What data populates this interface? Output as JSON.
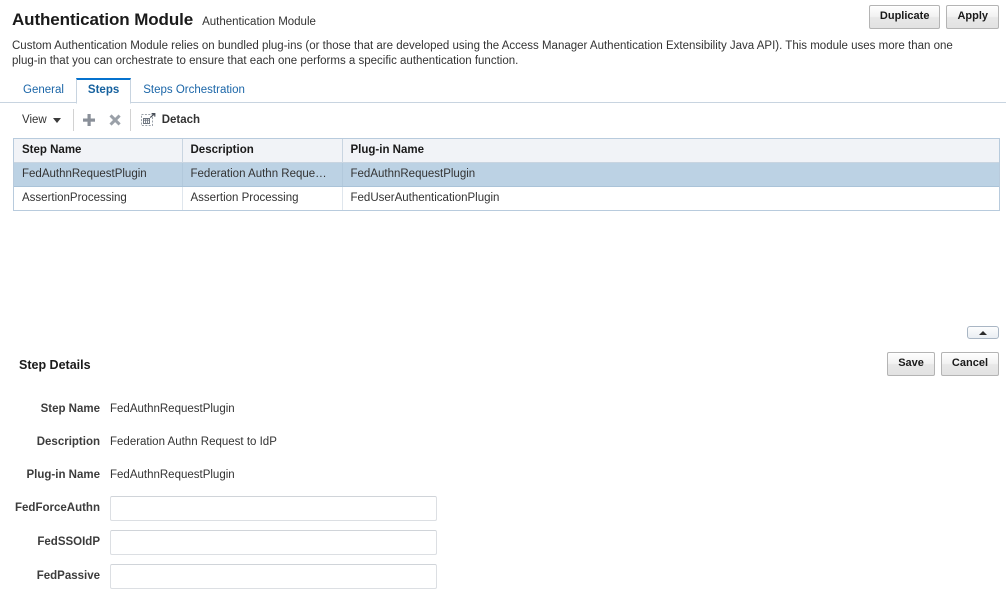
{
  "header": {
    "title": "Authentication Module",
    "subtitle": "Authentication Module",
    "duplicate_label": "Duplicate",
    "apply_label": "Apply"
  },
  "description": "Custom Authentication Module relies on bundled plug-ins (or those that are developed using the Access Manager Authentication Extensibility Java API). This module uses more than one plug-in that you can orchestrate to ensure that each one performs a specific authentication function.",
  "tabs": [
    {
      "label": "General",
      "active": false
    },
    {
      "label": "Steps",
      "active": true
    },
    {
      "label": "Steps Orchestration",
      "active": false
    }
  ],
  "toolbar": {
    "view_label": "View",
    "add_icon": "plus-icon",
    "delete_icon": "cross-icon",
    "detach_label": "Detach",
    "detach_icon": "detach-icon"
  },
  "table": {
    "columns": [
      "Step Name",
      "Description",
      "Plug-in Name"
    ],
    "rows": [
      {
        "selected": true,
        "cells": [
          "FedAuthnRequestPlugin",
          "Federation Authn Reque…",
          "FedAuthnRequestPlugin"
        ]
      },
      {
        "selected": false,
        "cells": [
          "AssertionProcessing",
          "Assertion Processing",
          "FedUserAuthenticationPlugin"
        ]
      }
    ]
  },
  "collapse_toggle": {
    "icon": "caret-up-icon"
  },
  "details": {
    "title": "Step Details",
    "save_label": "Save",
    "cancel_label": "Cancel",
    "readonly_fields": [
      {
        "label": "Step Name",
        "value": "FedAuthnRequestPlugin"
      },
      {
        "label": "Description",
        "value": "Federation Authn Request to IdP"
      },
      {
        "label": "Plug-in Name",
        "value": "FedAuthnRequestPlugin"
      }
    ],
    "input_fields": [
      {
        "label": "FedForceAuthn",
        "value": "",
        "placeholder": ""
      },
      {
        "label": "FedSSOIdP",
        "value": "",
        "placeholder": ""
      },
      {
        "label": "FedPassive",
        "value": "",
        "placeholder": ""
      }
    ]
  },
  "colors": {
    "accent": "#0572ce",
    "link": "#1b66a8",
    "selected_row": "#bcd2e4",
    "table_border": "#b8cbdd",
    "header_bg": "#f1f3f7"
  }
}
